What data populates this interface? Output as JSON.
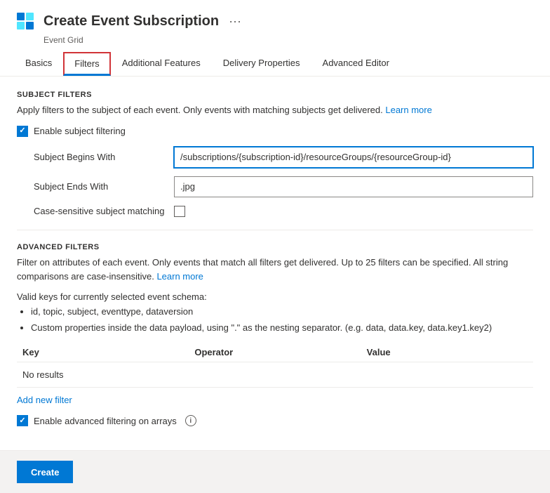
{
  "header": {
    "title": "Create Event Subscription",
    "subtitle": "Event Grid",
    "more_icon": "···"
  },
  "tabs": [
    {
      "id": "basics",
      "label": "Basics",
      "active": false,
      "outlined": false
    },
    {
      "id": "filters",
      "label": "Filters",
      "active": true,
      "outlined": true
    },
    {
      "id": "additional-features",
      "label": "Additional Features",
      "active": false,
      "outlined": false
    },
    {
      "id": "delivery-properties",
      "label": "Delivery Properties",
      "active": false,
      "outlined": false
    },
    {
      "id": "advanced-editor",
      "label": "Advanced Editor",
      "active": false,
      "outlined": false
    }
  ],
  "subject_filters": {
    "section_title": "SUBJECT FILTERS",
    "description": "Apply filters to the subject of each event. Only events with matching subjects get delivered.",
    "learn_more": "Learn more",
    "enable_label": "Enable subject filtering",
    "enable_checked": true,
    "begins_with_label": "Subject Begins With",
    "begins_with_value": "/subscriptions/{subscription-id}/resourceGroups/{resourceGroup-id}",
    "ends_with_label": "Subject Ends With",
    "ends_with_value": ".jpg",
    "case_sensitive_label": "Case-sensitive subject matching",
    "case_sensitive_checked": false
  },
  "advanced_filters": {
    "section_title": "ADVANCED FILTERS",
    "description": "Filter on attributes of each event. Only events that match all filters get delivered. Up to 25 filters can be specified. All string comparisons are case-insensitive.",
    "learn_more": "Learn more",
    "valid_keys_label": "Valid keys for currently selected event schema:",
    "valid_keys_items": [
      "id, topic, subject, eventtype, dataversion",
      "Custom properties inside the data payload, using \".\" as the nesting separator. (e.g. data, data.key, data.key1.key2)"
    ],
    "table_columns": [
      "Key",
      "Operator",
      "Value"
    ],
    "no_results": "No results",
    "add_filter_label": "Add new filter",
    "enable_arrays_label": "Enable advanced filtering on arrays",
    "enable_arrays_checked": true
  },
  "footer": {
    "create_button": "Create"
  }
}
